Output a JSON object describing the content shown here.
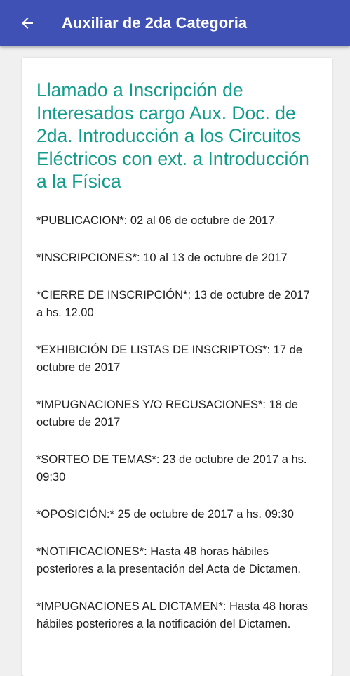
{
  "header": {
    "title": "Auxiliar de 2da Categoria",
    "back_icon": "arrow-back-icon"
  },
  "colors": {
    "app_bar": "#3f51b5",
    "title_accent": "#139c8c"
  },
  "card": {
    "title": "Llamado a Inscripción de Interesados cargo Aux. Doc. de 2da. Introducción a los Circuitos Eléctricos con ext. a Introducción a la Física",
    "entries": [
      "*PUBLICACION*: 02 al 06 de octubre de 2017",
      "*INSCRIPCIONES*: 10 al 13 de octubre de 2017",
      "*CIERRE DE INSCRIPCIÓN*: 13 de octubre de 2017 a hs. 12.00",
      "*EXHIBICIÓN DE LISTAS DE INSCRIPTOS*: 17 de octubre de 2017",
      "*IMPUGNACIONES Y/O RECUSACIONES*: 18 de octubre de 2017",
      "*SORTEO DE TEMAS*: 23 de octubre de 2017 a hs. 09:30",
      "*OPOSICIÓN:* 25 de octubre de 2017 a hs. 09:30",
      "*NOTIFICACIONES*: Hasta 48 horas hábiles posteriores a la presentación del Acta de Dictamen.",
      "*IMPUGNACIONES AL DICTAMEN*: Hasta 48 horas hábiles posteriores a la notificación del Dictamen."
    ]
  }
}
